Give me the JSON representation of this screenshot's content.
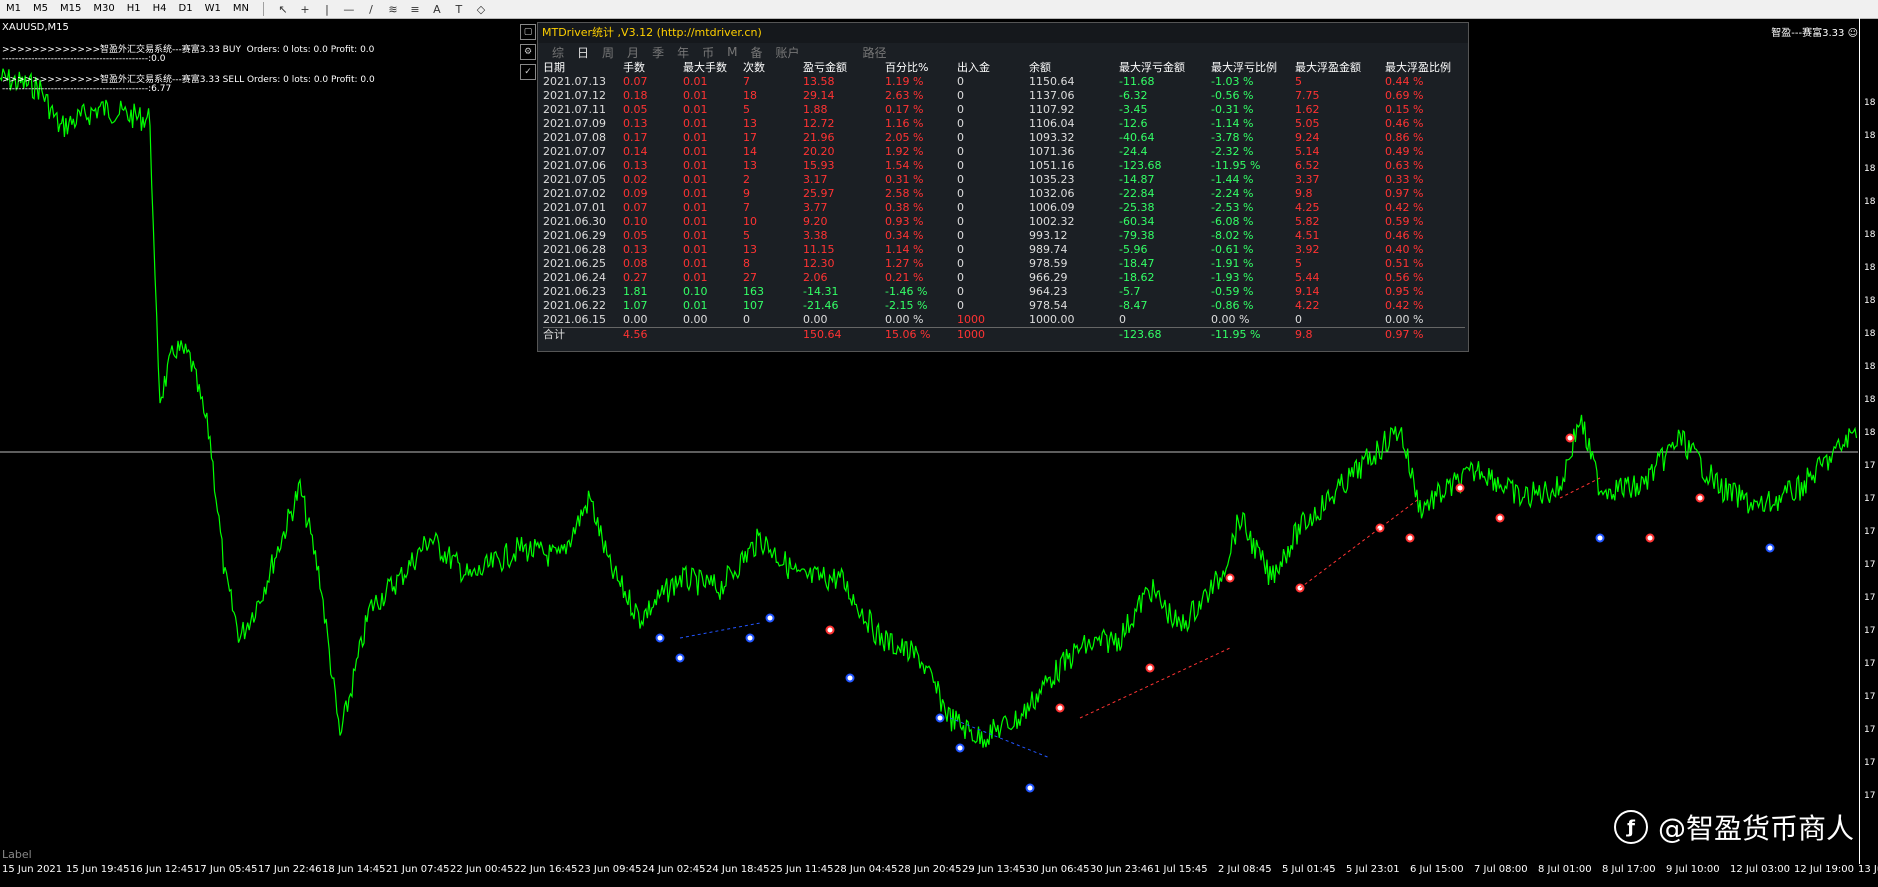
{
  "toolbar": {
    "timeframes": [
      "M1",
      "M5",
      "M15",
      "M30",
      "H1",
      "H4",
      "D1",
      "W1",
      "MN"
    ],
    "tools": [
      "cursor-icon",
      "crosshair-icon",
      "vline-icon",
      "hline-icon",
      "trendline-icon",
      "fibo-icon",
      "channel-icon",
      "text-icon",
      "label-icon",
      "shapes-icon"
    ]
  },
  "chart": {
    "symbol": "XAUUSD,M15",
    "buy_line": ">>>>>>>>>>>>>智盈外汇交易系统---赛富3.33 BUY  Orders: 0 lots: 0.0 Profit: 0.0",
    "buy_sub": "---------------------------------------------:0.0",
    "sell_line": ">>>>>>>>>>>>>智盈外汇交易系统---赛富3.33 SELL Orders: 0 lots: 0.0 Profit: 0.0",
    "sell_sub": "---------------------------------------------:6.77",
    "top_right": "智盈---赛富3.33 ☺",
    "label": "Label",
    "watermark": "@智盈货币商人",
    "x_labels": [
      "15 Jun 2021",
      "15 Jun 19:45",
      "16 Jun 12:45",
      "17 Jun 05:45",
      "17 Jun 22:46",
      "18 Jun 14:45",
      "21 Jun 07:45",
      "22 Jun 00:45",
      "22 Jun 16:45",
      "23 Jun 09:45",
      "24 Jun 02:45",
      "24 Jun 18:45",
      "25 Jun 11:45",
      "28 Jun 04:45",
      "28 Jun 20:45",
      "29 Jun 13:45",
      "30 Jun 06:45",
      "30 Jun 23:46",
      "1 Jul 15:45",
      "2 Jul 08:45",
      "5 Jul 01:45",
      "5 Jul 23:01",
      "6 Jul 15:00",
      "7 Jul 08:00",
      "8 Jul 01:00",
      "8 Jul 17:00",
      "9 Jul 10:00",
      "12 Jul 03:00",
      "12 Jul 19:00",
      "13 Jul"
    ],
    "y_labels": [
      "18",
      "18",
      "18",
      "18",
      "18",
      "18",
      "18",
      "18",
      "18",
      "18",
      "18",
      "17",
      "17",
      "17",
      "17",
      "17",
      "17",
      "17",
      "17",
      "17",
      "17",
      "17"
    ]
  },
  "panel": {
    "title": "MTDriver统计 ,V3.12 (http://mtdriver.cn)",
    "tabs": [
      "综",
      "日",
      "周",
      "月",
      "季",
      "年",
      "币",
      "M",
      "备",
      "账户",
      "路径"
    ],
    "active_tab": "日",
    "headers": [
      "日期",
      "手数",
      "最大手数",
      "次数",
      "盈亏金额",
      "百分比%",
      "出入金",
      "余额",
      "最大浮亏金额",
      "最大浮亏比例",
      "最大浮盈金额",
      "最大浮盈比例"
    ],
    "rows": [
      [
        "2021.07.13",
        "0.07",
        "0.01",
        "7",
        "13.58",
        "1.19 %",
        "0",
        "1150.64",
        "-11.68",
        "-1.03 %",
        "5",
        "0.44 %"
      ],
      [
        "2021.07.12",
        "0.18",
        "0.01",
        "18",
        "29.14",
        "2.63 %",
        "0",
        "1137.06",
        "-6.32",
        "-0.56 %",
        "7.75",
        "0.69 %"
      ],
      [
        "2021.07.11",
        "0.05",
        "0.01",
        "5",
        "1.88",
        "0.17 %",
        "0",
        "1107.92",
        "-3.45",
        "-0.31 %",
        "1.62",
        "0.15 %"
      ],
      [
        "2021.07.09",
        "0.13",
        "0.01",
        "13",
        "12.72",
        "1.16 %",
        "0",
        "1106.04",
        "-12.6",
        "-1.14 %",
        "5.05",
        "0.46 %"
      ],
      [
        "2021.07.08",
        "0.17",
        "0.01",
        "17",
        "21.96",
        "2.05 %",
        "0",
        "1093.32",
        "-40.64",
        "-3.78 %",
        "9.24",
        "0.86 %"
      ],
      [
        "2021.07.07",
        "0.14",
        "0.01",
        "14",
        "20.20",
        "1.92 %",
        "0",
        "1071.36",
        "-24.4",
        "-2.32 %",
        "5.14",
        "0.49 %"
      ],
      [
        "2021.07.06",
        "0.13",
        "0.01",
        "13",
        "15.93",
        "1.54 %",
        "0",
        "1051.16",
        "-123.68",
        "-11.95 %",
        "6.52",
        "0.63 %"
      ],
      [
        "2021.07.05",
        "0.02",
        "0.01",
        "2",
        "3.17",
        "0.31 %",
        "0",
        "1035.23",
        "-14.87",
        "-1.44 %",
        "3.37",
        "0.33 %"
      ],
      [
        "2021.07.02",
        "0.09",
        "0.01",
        "9",
        "25.97",
        "2.58 %",
        "0",
        "1032.06",
        "-22.84",
        "-2.24 %",
        "9.8",
        "0.97 %"
      ],
      [
        "2021.07.01",
        "0.07",
        "0.01",
        "7",
        "3.77",
        "0.38 %",
        "0",
        "1006.09",
        "-25.38",
        "-2.53 %",
        "4.25",
        "0.42 %"
      ],
      [
        "2021.06.30",
        "0.10",
        "0.01",
        "10",
        "9.20",
        "0.93 %",
        "0",
        "1002.32",
        "-60.34",
        "-6.08 %",
        "5.82",
        "0.59 %"
      ],
      [
        "2021.06.29",
        "0.05",
        "0.01",
        "5",
        "3.38",
        "0.34 %",
        "0",
        "993.12",
        "-79.38",
        "-8.02 %",
        "4.51",
        "0.46 %"
      ],
      [
        "2021.06.28",
        "0.13",
        "0.01",
        "13",
        "11.15",
        "1.14 %",
        "0",
        "989.74",
        "-5.96",
        "-0.61 %",
        "3.92",
        "0.40 %"
      ],
      [
        "2021.06.25",
        "0.08",
        "0.01",
        "8",
        "12.30",
        "1.27 %",
        "0",
        "978.59",
        "-18.47",
        "-1.91 %",
        "5",
        "0.51 %"
      ],
      [
        "2021.06.24",
        "0.27",
        "0.01",
        "27",
        "2.06",
        "0.21 %",
        "0",
        "966.29",
        "-18.62",
        "-1.93 %",
        "5.44",
        "0.56 %"
      ],
      [
        "2021.06.23",
        "1.81",
        "0.10",
        "163",
        "-14.31",
        "-1.46 %",
        "0",
        "964.23",
        "-5.7",
        "-0.59 %",
        "9.14",
        "0.95 %"
      ],
      [
        "2021.06.22",
        "1.07",
        "0.01",
        "107",
        "-21.46",
        "-2.15 %",
        "0",
        "978.54",
        "-8.47",
        "-0.86 %",
        "4.22",
        "0.42 %"
      ],
      [
        "2021.06.15",
        "0.00",
        "0.00",
        "0",
        "0.00",
        "0.00 %",
        "1000",
        "1000.00",
        "0",
        "0.00 %",
        "0",
        "0.00 %"
      ]
    ],
    "total": [
      "合计",
      "4.56",
      "",
      "",
      "150.64",
      "15.06 %",
      "1000",
      "",
      "-123.68",
      "-11.95 %",
      "9.8",
      "0.97 %"
    ]
  },
  "colors": {
    "up": "#ff3333",
    "down": "#33ff66",
    "neutral": "#dddddd",
    "price_line": "#00ff00",
    "title": "#ffd000"
  }
}
